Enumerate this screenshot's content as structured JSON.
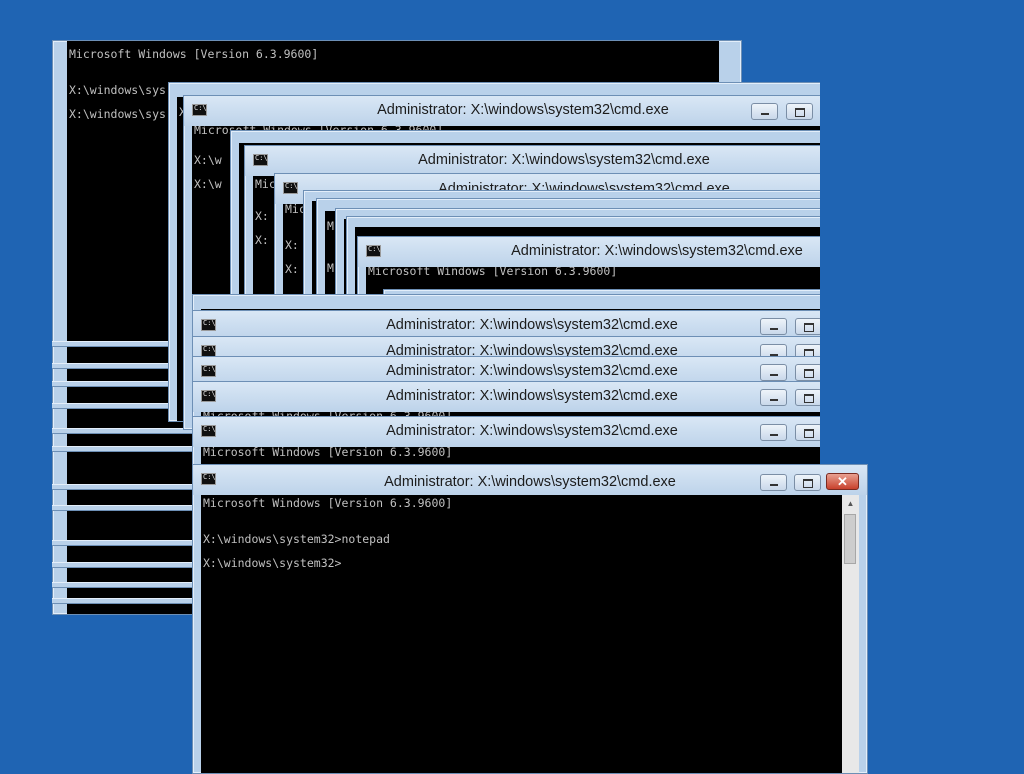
{
  "window_title": "Administrator: X:\\windows\\system32\\cmd.exe",
  "console": {
    "version_line": "Microsoft Windows [Version 6.3.9600]",
    "line_prompt_notepad": "X:\\windows\\system32>notepad",
    "line_prompt": "X:\\windows\\system32>",
    "partial_version_top": "Microsoft Windows [Version 6.3.9600]",
    "partial_prompt_1": "X:\\windows\\sys",
    "partial_prompt_2": "X:\\windows\\sys",
    "partial_short_1": "X:\\w",
    "partial_short_2": "X:\\w",
    "partial_mic": "Mic",
    "partial_x": "X:",
    "partial_m": "M"
  },
  "controls": {
    "minimize_label": "",
    "maximize_label": "",
    "close_label": "✕"
  },
  "colors": {
    "desktop": "#1f64b3",
    "window_frame": "#b9d1ea",
    "console_bg": "#000000",
    "console_text": "#c0c0c0",
    "close_button": "#c8412c"
  }
}
